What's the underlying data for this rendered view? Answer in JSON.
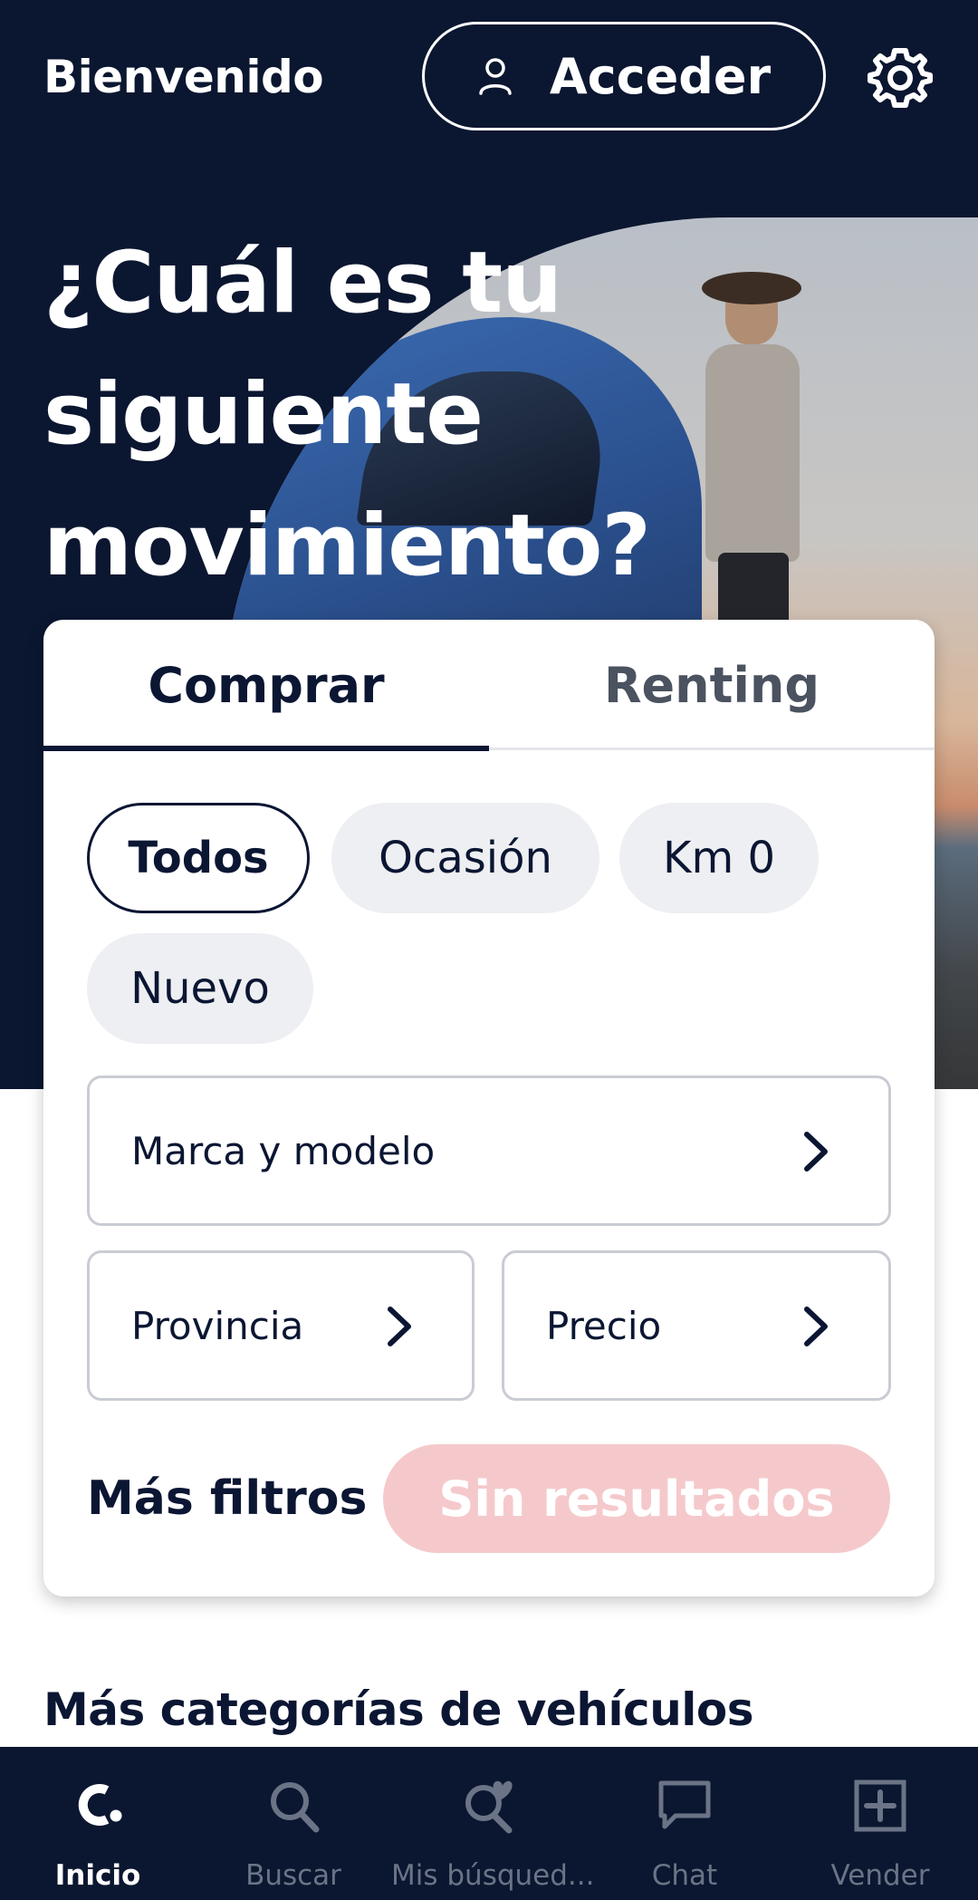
{
  "header": {
    "title": "Bienvenido",
    "login_label": "Acceder",
    "login_icon": "user-icon",
    "settings_icon": "gear-icon"
  },
  "hero": {
    "headline": "¿Cuál es tu siguiente movimiento?"
  },
  "search_card": {
    "tabs": [
      {
        "label": "Comprar",
        "active": true
      },
      {
        "label": "Renting",
        "active": false
      }
    ],
    "chips": [
      {
        "label": "Todos",
        "selected": true
      },
      {
        "label": "Ocasión",
        "selected": false
      },
      {
        "label": "Km 0",
        "selected": false
      },
      {
        "label": "Nuevo",
        "selected": false
      }
    ],
    "fields": {
      "brand_model": "Marca y modelo",
      "province": "Provincia",
      "price": "Precio"
    },
    "more_filters": "Más filtros",
    "results_button": "Sin resultados"
  },
  "sections": {
    "more_categories": "Más categorías de vehículos"
  },
  "bottom_nav": {
    "items": [
      {
        "label": "Inicio",
        "icon": "logo-icon",
        "active": true
      },
      {
        "label": "Buscar",
        "icon": "search-icon",
        "active": false
      },
      {
        "label": "Mis búsqued...",
        "icon": "saved-search-heart-icon",
        "active": false
      },
      {
        "label": "Chat",
        "icon": "chat-icon",
        "active": false
      },
      {
        "label": "Vender",
        "icon": "plus-square-icon",
        "active": false
      }
    ]
  },
  "colors": {
    "navy": "#0b1630",
    "text": "#0b1633",
    "chip_bg": "#eeeff2",
    "disabled_button": "#f5c9cb",
    "nav_inactive": "#6b7486"
  }
}
